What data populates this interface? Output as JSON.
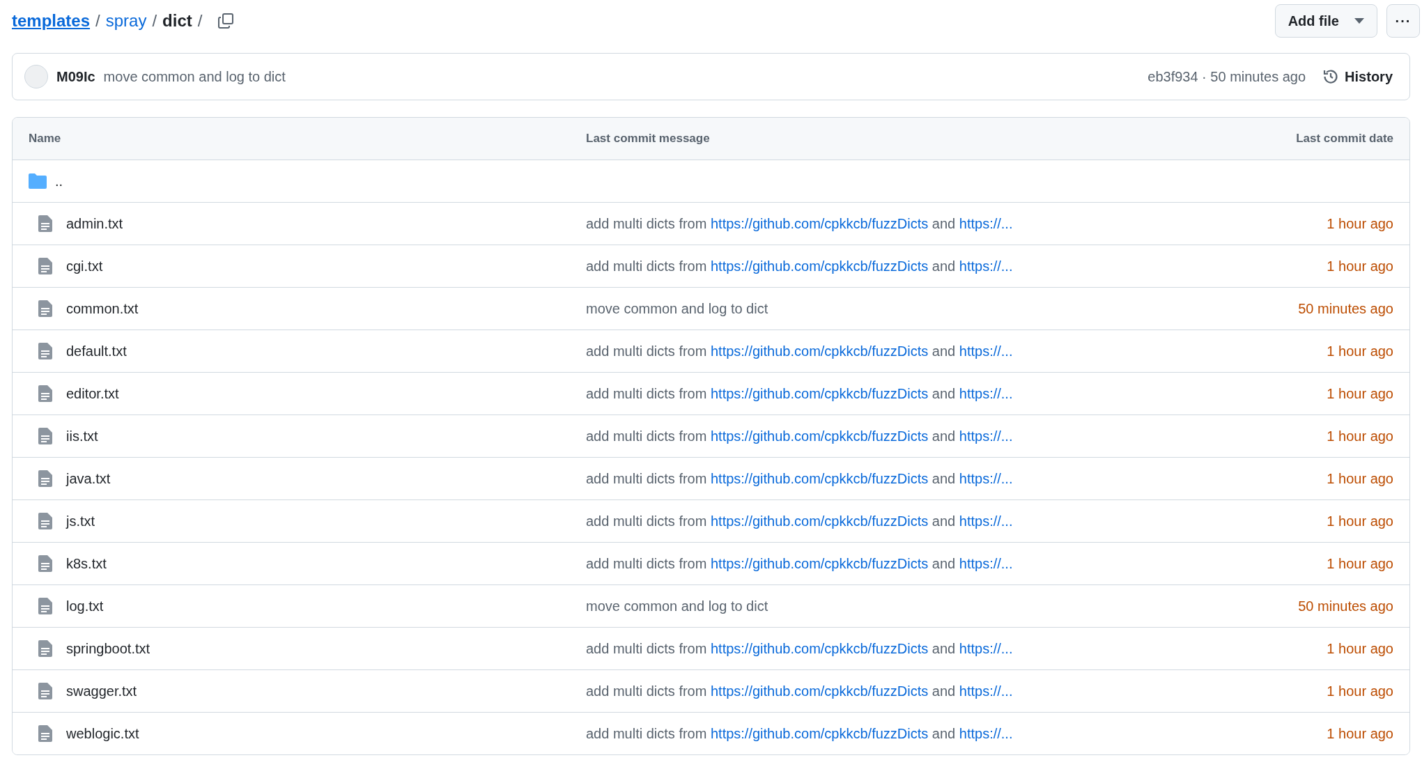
{
  "breadcrumb": [
    {
      "label": "templates",
      "kind": "root"
    },
    {
      "label": "spray",
      "kind": "link"
    },
    {
      "label": "dict",
      "kind": "current"
    }
  ],
  "separator": "/",
  "actions": {
    "add_file": "Add file",
    "more": "···"
  },
  "commit": {
    "author": "M09Ic",
    "message": "move common and log to dict",
    "meta": "eb3f934 · 50 minutes ago",
    "history": "History"
  },
  "table": {
    "columns": [
      "Name",
      "Last commit message",
      "Last commit date"
    ],
    "parent": "..",
    "rows": [
      {
        "name": "admin.txt",
        "message": [
          {
            "kind": "text",
            "text": "add multi dicts from "
          },
          {
            "kind": "link",
            "text": "https://github.com/cpkkcb/fuzzDicts"
          },
          {
            "kind": "text",
            "text": " and "
          },
          {
            "kind": "link",
            "text": "https://..."
          }
        ],
        "date": "1 hour ago"
      },
      {
        "name": "cgi.txt",
        "message": [
          {
            "kind": "text",
            "text": "add multi dicts from "
          },
          {
            "kind": "link",
            "text": "https://github.com/cpkkcb/fuzzDicts"
          },
          {
            "kind": "text",
            "text": " and "
          },
          {
            "kind": "link",
            "text": "https://..."
          }
        ],
        "date": "1 hour ago"
      },
      {
        "name": "common.txt",
        "message": [
          {
            "kind": "text",
            "text": "move common and log to dict"
          }
        ],
        "date": "50 minutes ago"
      },
      {
        "name": "default.txt",
        "message": [
          {
            "kind": "text",
            "text": "add multi dicts from "
          },
          {
            "kind": "link",
            "text": "https://github.com/cpkkcb/fuzzDicts"
          },
          {
            "kind": "text",
            "text": " and "
          },
          {
            "kind": "link",
            "text": "https://..."
          }
        ],
        "date": "1 hour ago"
      },
      {
        "name": "editor.txt",
        "message": [
          {
            "kind": "text",
            "text": "add multi dicts from "
          },
          {
            "kind": "link",
            "text": "https://github.com/cpkkcb/fuzzDicts"
          },
          {
            "kind": "text",
            "text": " and "
          },
          {
            "kind": "link",
            "text": "https://..."
          }
        ],
        "date": "1 hour ago"
      },
      {
        "name": "iis.txt",
        "message": [
          {
            "kind": "text",
            "text": "add multi dicts from "
          },
          {
            "kind": "link",
            "text": "https://github.com/cpkkcb/fuzzDicts"
          },
          {
            "kind": "text",
            "text": " and "
          },
          {
            "kind": "link",
            "text": "https://..."
          }
        ],
        "date": "1 hour ago"
      },
      {
        "name": "java.txt",
        "message": [
          {
            "kind": "text",
            "text": "add multi dicts from "
          },
          {
            "kind": "link",
            "text": "https://github.com/cpkkcb/fuzzDicts"
          },
          {
            "kind": "text",
            "text": " and "
          },
          {
            "kind": "link",
            "text": "https://..."
          }
        ],
        "date": "1 hour ago"
      },
      {
        "name": "js.txt",
        "message": [
          {
            "kind": "text",
            "text": "add multi dicts from "
          },
          {
            "kind": "link",
            "text": "https://github.com/cpkkcb/fuzzDicts"
          },
          {
            "kind": "text",
            "text": " and "
          },
          {
            "kind": "link",
            "text": "https://..."
          }
        ],
        "date": "1 hour ago"
      },
      {
        "name": "k8s.txt",
        "message": [
          {
            "kind": "text",
            "text": "add multi dicts from "
          },
          {
            "kind": "link",
            "text": "https://github.com/cpkkcb/fuzzDicts"
          },
          {
            "kind": "text",
            "text": " and "
          },
          {
            "kind": "link",
            "text": "https://..."
          }
        ],
        "date": "1 hour ago"
      },
      {
        "name": "log.txt",
        "message": [
          {
            "kind": "text",
            "text": "move common and log to dict"
          }
        ],
        "date": "50 minutes ago"
      },
      {
        "name": "springboot.txt",
        "message": [
          {
            "kind": "text",
            "text": "add multi dicts from "
          },
          {
            "kind": "link",
            "text": "https://github.com/cpkkcb/fuzzDicts"
          },
          {
            "kind": "text",
            "text": " and "
          },
          {
            "kind": "link",
            "text": "https://..."
          }
        ],
        "date": "1 hour ago"
      },
      {
        "name": "swagger.txt",
        "message": [
          {
            "kind": "text",
            "text": "add multi dicts from "
          },
          {
            "kind": "link",
            "text": "https://github.com/cpkkcb/fuzzDicts"
          },
          {
            "kind": "text",
            "text": " and "
          },
          {
            "kind": "link",
            "text": "https://..."
          }
        ],
        "date": "1 hour ago"
      },
      {
        "name": "weblogic.txt",
        "message": [
          {
            "kind": "text",
            "text": "add multi dicts from "
          },
          {
            "kind": "link",
            "text": "https://github.com/cpkkcb/fuzzDicts"
          },
          {
            "kind": "text",
            "text": " and "
          },
          {
            "kind": "link",
            "text": "https://..."
          }
        ],
        "date": "1 hour ago"
      }
    ]
  }
}
